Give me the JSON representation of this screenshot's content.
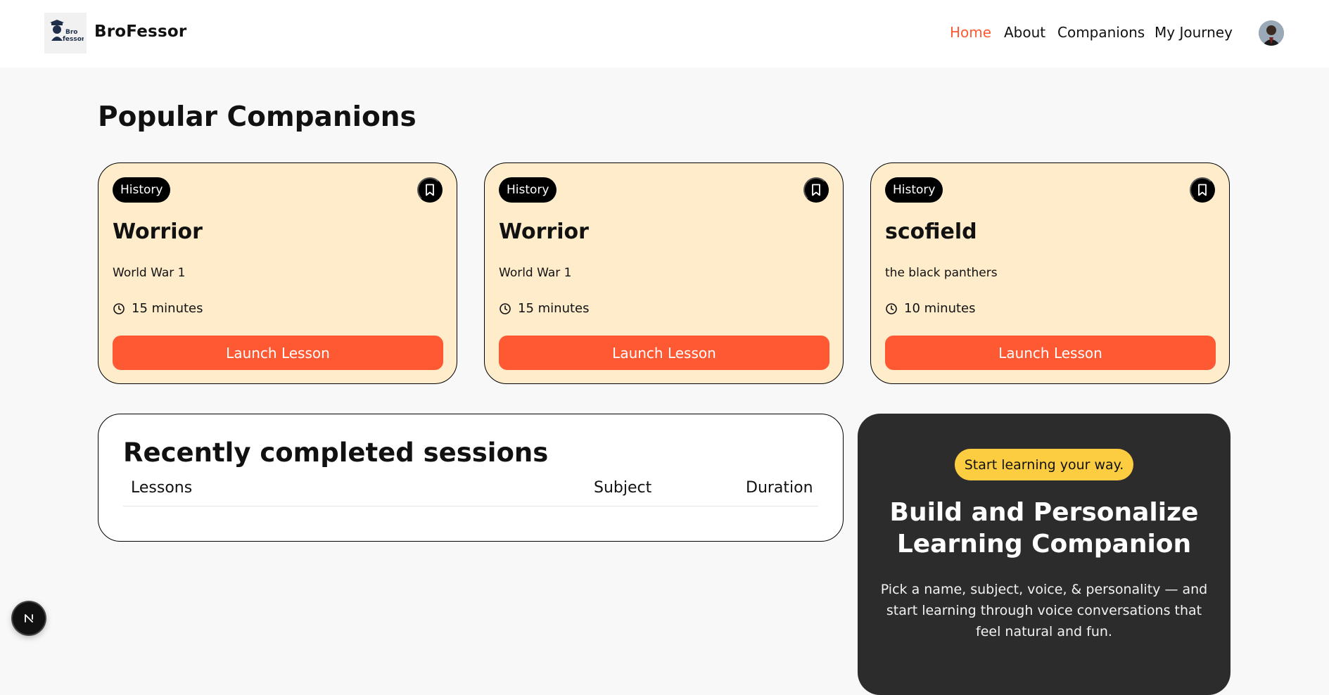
{
  "header": {
    "brand": "BroFessor",
    "logo_text": [
      "Bro",
      "fessor"
    ],
    "nav": [
      {
        "label": "Home",
        "active": true
      },
      {
        "label": "About",
        "active": false
      },
      {
        "label": "Companions",
        "active": false
      },
      {
        "label": "My Journey",
        "active": false
      }
    ],
    "avatar_icon": "user-avatar"
  },
  "popular": {
    "title": "Popular Companions",
    "cards": [
      {
        "subject": "History",
        "name": "Worrior",
        "topic": "World War 1",
        "duration": "15 minutes",
        "button": "Launch Lesson",
        "bookmark_icon": "bookmark-icon",
        "clock_icon": "clock-icon"
      },
      {
        "subject": "History",
        "name": "Worrior",
        "topic": "World War 1",
        "duration": "15 minutes",
        "button": "Launch Lesson",
        "bookmark_icon": "bookmark-icon",
        "clock_icon": "clock-icon"
      },
      {
        "subject": "History",
        "name": "scofield",
        "topic": "the black panthers",
        "duration": "10 minutes",
        "button": "Launch Lesson",
        "bookmark_icon": "bookmark-icon",
        "clock_icon": "clock-icon"
      }
    ]
  },
  "sessions": {
    "title": "Recently completed sessions",
    "columns": [
      "Lessons",
      "Subject",
      "Duration"
    ],
    "rows": []
  },
  "cta": {
    "badge": "Start learning your way.",
    "title": "Build and Personalize Learning Companion",
    "description": "Pick a name, subject, voice, & personality — and start learning through voice conversations that feel natural and fun."
  },
  "dev_tools": {
    "label": "N"
  },
  "colors": {
    "accent": "#fe5933",
    "card_bg": "#feeccb",
    "cta_bg": "#2c2c2c",
    "cta_badge": "#fccc41",
    "page_bg": "#f8f8f8"
  }
}
